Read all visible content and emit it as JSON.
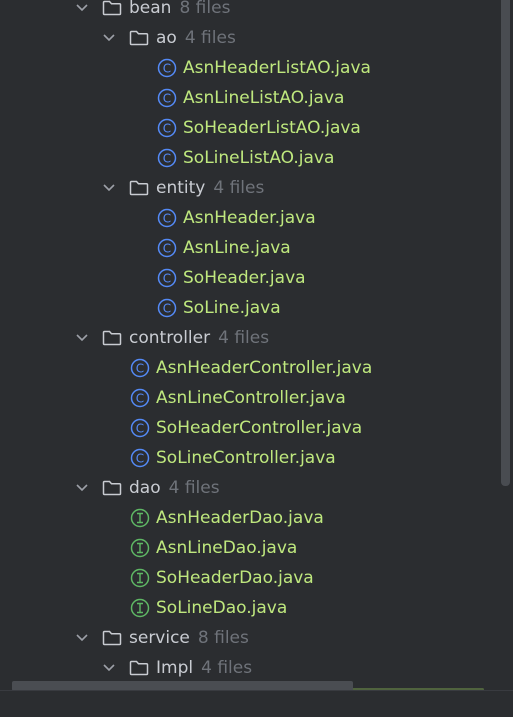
{
  "colors": {
    "background": "#2b2d30",
    "folder_text": "#c9ccd2",
    "file_text": "#bfe87e",
    "count_text": "#6f737a",
    "class_icon": "#548af7",
    "interface_icon": "#5fb865"
  },
  "tree": {
    "bean": {
      "name": "bean",
      "count": "8 files"
    },
    "ao": {
      "name": "ao",
      "count": "4 files"
    },
    "ao_files": [
      {
        "name": "AsnHeaderListAO.java",
        "icon": "class-icon"
      },
      {
        "name": "AsnLineListAO.java",
        "icon": "class-icon"
      },
      {
        "name": "SoHeaderListAO.java",
        "icon": "class-icon"
      },
      {
        "name": "SoLineListAO.java",
        "icon": "class-icon"
      }
    ],
    "entity": {
      "name": "entity",
      "count": "4 files"
    },
    "entity_files": [
      {
        "name": "AsnHeader.java",
        "icon": "class-icon"
      },
      {
        "name": "AsnLine.java",
        "icon": "class-icon"
      },
      {
        "name": "SoHeader.java",
        "icon": "class-icon"
      },
      {
        "name": "SoLine.java",
        "icon": "class-icon"
      }
    ],
    "controller": {
      "name": "controller",
      "count": "4 files"
    },
    "controller_files": [
      {
        "name": "AsnHeaderController.java",
        "icon": "class-icon"
      },
      {
        "name": "AsnLineController.java",
        "icon": "class-icon"
      },
      {
        "name": "SoHeaderController.java",
        "icon": "class-icon"
      },
      {
        "name": "SoLineController.java",
        "icon": "class-icon"
      }
    ],
    "dao": {
      "name": "dao",
      "count": "4 files"
    },
    "dao_files": [
      {
        "name": "AsnHeaderDao.java",
        "icon": "interface-icon"
      },
      {
        "name": "AsnLineDao.java",
        "icon": "interface-icon"
      },
      {
        "name": "SoHeaderDao.java",
        "icon": "interface-icon"
      },
      {
        "name": "SoLineDao.java",
        "icon": "interface-icon"
      }
    ],
    "service": {
      "name": "service",
      "count": "8 files"
    },
    "impl": {
      "name": "Impl",
      "count": "4 files"
    }
  }
}
